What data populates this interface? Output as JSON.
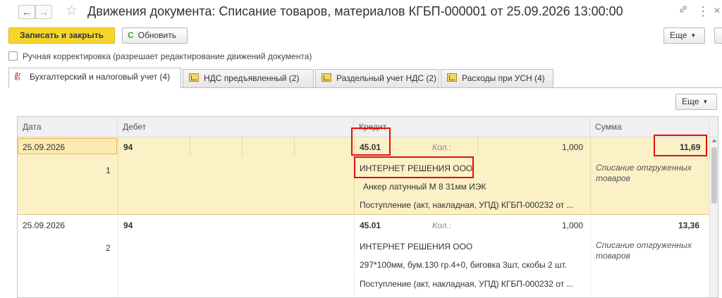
{
  "window": {
    "title": "Движения документа: Списание товаров, материалов КГБП-000001 от 25.09.2026 13:00:00",
    "back_icon": "←",
    "forward_icon": "→",
    "star_icon": "☆",
    "link_icon": "🔗",
    "more_icon": "⋮",
    "close_icon": "×"
  },
  "toolbar": {
    "save_close_label": "Записать и закрыть",
    "refresh_label": "Обновить",
    "refresh_icon": "C",
    "more_label": "Еще",
    "caret": "▼"
  },
  "manual_adjustment": {
    "label": "Ручная корректировка (разрешает редактирование движений документа)",
    "checked": false
  },
  "tabs": [
    {
      "label": "Бухгалтерский и налоговый учет (4)",
      "active": true,
      "icon": "dt-kt-icon"
    },
    {
      "label": "НДС предъявленный (2)",
      "active": false,
      "icon": "register-icon"
    },
    {
      "label": "Раздельный учет НДС (2)",
      "active": false,
      "icon": "register-icon"
    },
    {
      "label": "Расходы при УСН (4)",
      "active": false,
      "icon": "register-icon"
    }
  ],
  "tab_icon_text": {
    "dt": "Дт",
    "kt": "Кт"
  },
  "table": {
    "more_label": "Еще",
    "columns": [
      "Дата",
      "Дебет",
      "Кредит",
      "Сумма"
    ],
    "rows": [
      {
        "date": "25.09.2026",
        "number": "1",
        "debit_account": "94",
        "credit_account": "45.01",
        "qty_label": "Кол.:",
        "qty_value": "1,000",
        "credit_subconto1": "ИНТЕРНЕТ РЕШЕНИЯ ООО",
        "credit_subconto2": "Анкер латунный М 8  31мм ИЭК",
        "credit_subconto3": "Поступление (акт, накладная, УПД) КГБП-000232 от ...",
        "amount": "11,69",
        "content": "Списание отгруженных товаров"
      },
      {
        "date": "25.09.2026",
        "number": "2",
        "debit_account": "94",
        "credit_account": "45.01",
        "qty_label": "Кол.:",
        "qty_value": "1,000",
        "credit_subconto1": "ИНТЕРНЕТ РЕШЕНИЯ ООО",
        "credit_subconto2": "297*100мм, бум.130 гр.4+0, биговка 3шт, скобы 2 шт.",
        "credit_subconto3": "Поступление (акт, накладная, УПД) КГБП-000232 от ...",
        "amount": "13,36",
        "content": "Списание отгруженных товаров"
      }
    ]
  },
  "colors": {
    "primary_button": "#f6d52f",
    "selected_row": "#fbf0c6",
    "highlight_box": "#e01010"
  }
}
